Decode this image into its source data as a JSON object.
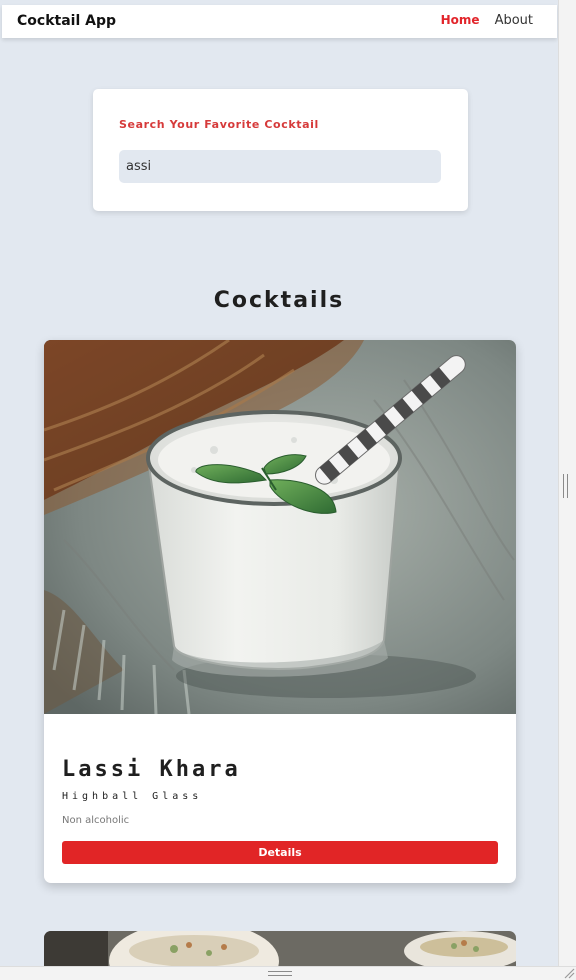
{
  "navbar": {
    "brand": "Cocktail App",
    "links": [
      {
        "label": "Home",
        "active": true
      },
      {
        "label": "About",
        "active": false
      }
    ]
  },
  "search": {
    "label": "Search Your Favorite Cocktail",
    "value": "assi"
  },
  "cocktails": {
    "section_title": "Cocktails",
    "items": [
      {
        "name": "Lassi Khara",
        "glass": "Highball Glass",
        "alcoholic": "Non alcoholic",
        "details_label": "Details"
      }
    ]
  },
  "colors": {
    "accent": "#e12526",
    "background": "#e2e8f0",
    "card": "#ffffff"
  },
  "icons": {
    "resize_handle": "resize-grip-icon"
  }
}
